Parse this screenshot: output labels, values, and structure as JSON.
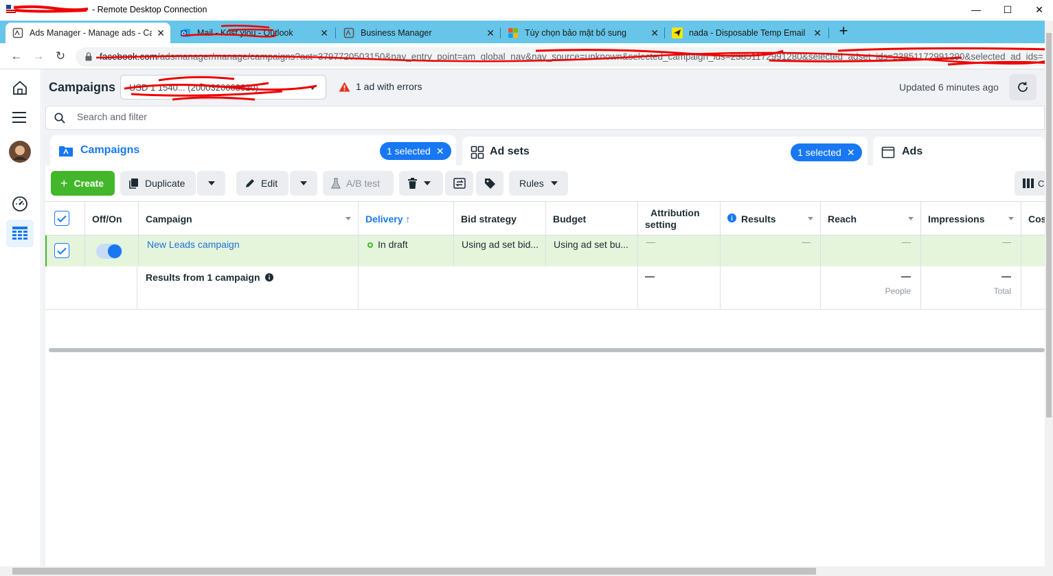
{
  "window": {
    "title": "- Remote Desktop Connection",
    "controls": {
      "minimize": "—",
      "maximize": "☐",
      "close": "✕"
    }
  },
  "browser": {
    "tabs": [
      {
        "title": "Ads Manager - Manage ads - Ca",
        "icon": "ads-manager-icon",
        "active": true
      },
      {
        "title": "Mail - Krist    ylou - Outlook",
        "icon": "outlook-icon",
        "active": false
      },
      {
        "title": "Business Manager",
        "icon": "business-manager-icon",
        "active": false
      },
      {
        "title": "Tùy chọn bảo mật bổ sung",
        "icon": "microsoft-icon",
        "active": false
      },
      {
        "title": "nada - Disposable Temp Email",
        "icon": "nada-icon",
        "active": false
      }
    ],
    "new_tab": "+",
    "url": {
      "domain": "facebook.com",
      "path": "/adsmanager/manage/campaigns?act=3797720503150&nav_entry_point=am_global_nav&nav_source=unknown&selected_campaign_ids=23851172991280&selected_adset_ids=23851172991290&selected_ad_ids="
    }
  },
  "header": {
    "title": "Campaigns",
    "account": "USD 1 1540... (2000320003620)",
    "error_text": "1 ad with errors",
    "updated": "Updated 6 minutes ago"
  },
  "search": {
    "placeholder": "Search and filter"
  },
  "level_tabs": {
    "campaigns": {
      "label": "Campaigns",
      "selected": "1 selected"
    },
    "adsets": {
      "label": "Ad sets",
      "selected": "1 selected"
    },
    "ads": {
      "label": "Ads"
    }
  },
  "toolbar": {
    "create": "Create",
    "duplicate": "Duplicate",
    "edit": "Edit",
    "ab_test": "A/B test",
    "rules": "Rules"
  },
  "table": {
    "columns": {
      "offon": "Off/On",
      "campaign": "Campaign",
      "delivery": "Delivery",
      "bid": "Bid strategy",
      "budget": "Budget",
      "attribution_1": "Attribution",
      "attribution_2": "setting",
      "results": "Results",
      "reach": "Reach",
      "impressions": "Impressions",
      "cost": "Cos"
    },
    "rows": [
      {
        "name": "New Leads campaign",
        "delivery": "In draft",
        "bid": "Using ad set bid...",
        "budget": "Using ad set bu...",
        "attribution": "—",
        "results": "—",
        "reach": "—",
        "impressions": "—"
      }
    ],
    "summary": {
      "label": "Results from 1 campaign",
      "attribution": "—",
      "reach": "—",
      "reach_sub": "People",
      "impressions": "—",
      "impressions_sub": "Total"
    }
  },
  "colors": {
    "accent": "#1877f2",
    "create_green": "#42b72a",
    "selected_row": "#e4f5dc",
    "tabstrip": "#66c5e8"
  }
}
